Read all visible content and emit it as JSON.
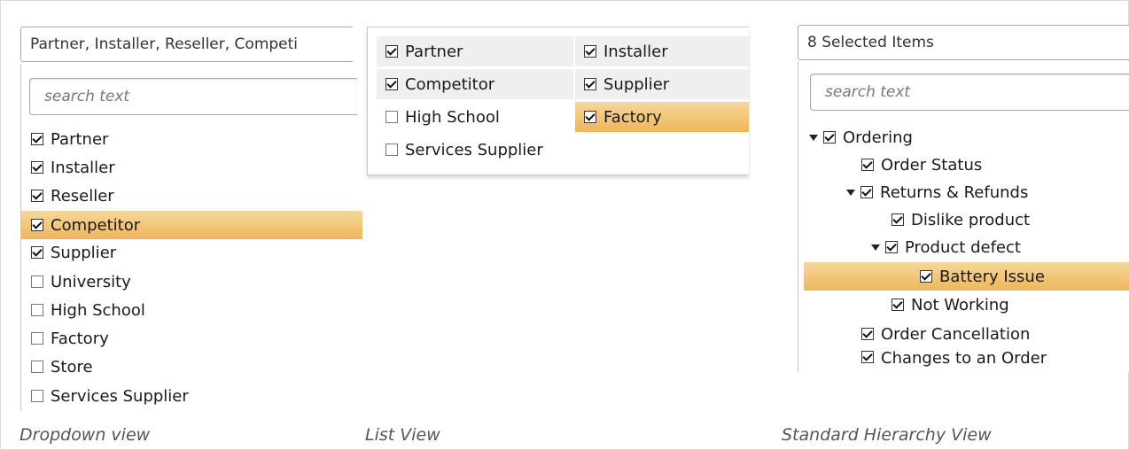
{
  "dropdown": {
    "combo_text": "Partner, Installer, Reseller, Competi",
    "search_placeholder": "search text",
    "items": [
      {
        "label": "Partner",
        "checked": true
      },
      {
        "label": "Installer",
        "checked": true
      },
      {
        "label": "Reseller",
        "checked": true
      },
      {
        "label": "Competitor",
        "checked": true,
        "highlighted": true
      },
      {
        "label": "Supplier",
        "checked": true
      },
      {
        "label": "University",
        "checked": false
      },
      {
        "label": "High School",
        "checked": false
      },
      {
        "label": "Factory",
        "checked": false
      },
      {
        "label": "Store",
        "checked": false
      },
      {
        "label": "Services Supplier",
        "checked": false
      }
    ],
    "caption": "Dropdown view"
  },
  "list": {
    "items": [
      {
        "label": "Partner",
        "checked": true
      },
      {
        "label": "Installer",
        "checked": true
      },
      {
        "label": "Competitor",
        "checked": true
      },
      {
        "label": "Supplier",
        "checked": true
      },
      {
        "label": "High School",
        "checked": false
      },
      {
        "label": "Factory",
        "checked": true,
        "highlighted": true
      },
      {
        "label": "Services Supplier",
        "checked": false
      }
    ],
    "caption": "List View"
  },
  "hierarchy": {
    "combo_text": "8 Selected Items",
    "search_placeholder": "search text",
    "items": [
      {
        "label": "Ordering",
        "checked": true,
        "level": 0,
        "expanded": true
      },
      {
        "label": "Order Status",
        "checked": true,
        "level": 1
      },
      {
        "label": "Returns & Refunds",
        "checked": true,
        "level": 1,
        "expanded": true
      },
      {
        "label": "Dislike product",
        "checked": true,
        "level": 2
      },
      {
        "label": "Product defect",
        "checked": true,
        "level": 2,
        "expanded": true
      },
      {
        "label": "Battery Issue",
        "checked": true,
        "level": 3,
        "highlighted": true
      },
      {
        "label": "Not Working",
        "checked": true,
        "level": 2
      },
      {
        "label": "Order Cancellation",
        "checked": true,
        "level": 1
      },
      {
        "label": "Changes to an Order",
        "checked": true,
        "level": 1
      }
    ],
    "caption": "Standard Hierarchy View"
  },
  "colors": {
    "highlight_top": "#f6d89a",
    "highlight_bottom": "#eeb65a",
    "border": "#a9a9a9"
  }
}
